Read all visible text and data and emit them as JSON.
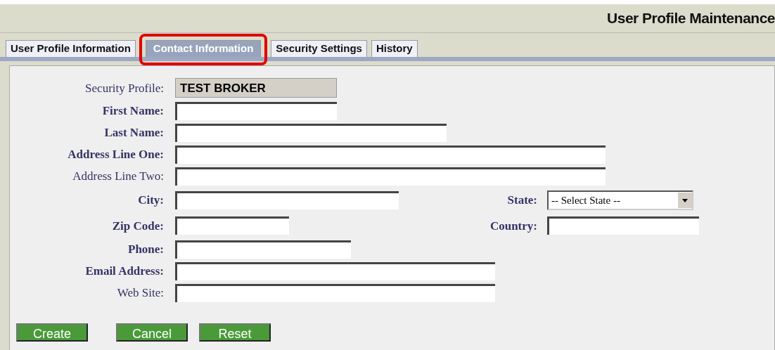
{
  "header": {
    "title": "User Profile Maintenance"
  },
  "tabs": [
    {
      "label": "User Profile Information",
      "selected": false
    },
    {
      "label": "Contact Information",
      "selected": true
    },
    {
      "label": "Security Settings",
      "selected": false
    },
    {
      "label": "History",
      "selected": false
    }
  ],
  "form": {
    "rows": [
      {
        "label": "Security Profile:",
        "bold": false,
        "kind": "readonly",
        "value": "TEST BROKER"
      },
      {
        "label": "First Name:",
        "bold": true,
        "kind": "text"
      },
      {
        "label": "Last Name:",
        "bold": true,
        "kind": "text"
      },
      {
        "label": "Address Line One:",
        "bold": true,
        "kind": "text"
      },
      {
        "label": "Address Line Two:",
        "bold": false,
        "kind": "text"
      },
      {
        "label": "City:",
        "bold": true,
        "kind": "text",
        "side": {
          "label": "State:",
          "bold": true,
          "kind": "select",
          "value": "-- Select State --"
        }
      },
      {
        "label": "Zip Code:",
        "bold": true,
        "kind": "text",
        "side": {
          "label": "Country:",
          "bold": true,
          "kind": "text"
        }
      },
      {
        "label": "Phone:",
        "bold": true,
        "kind": "text"
      },
      {
        "label": "Email Address:",
        "bold": true,
        "kind": "text"
      },
      {
        "label": "Web Site:",
        "bold": false,
        "kind": "text"
      }
    ]
  },
  "buttons": [
    "Create",
    "Cancel",
    "Reset"
  ]
}
